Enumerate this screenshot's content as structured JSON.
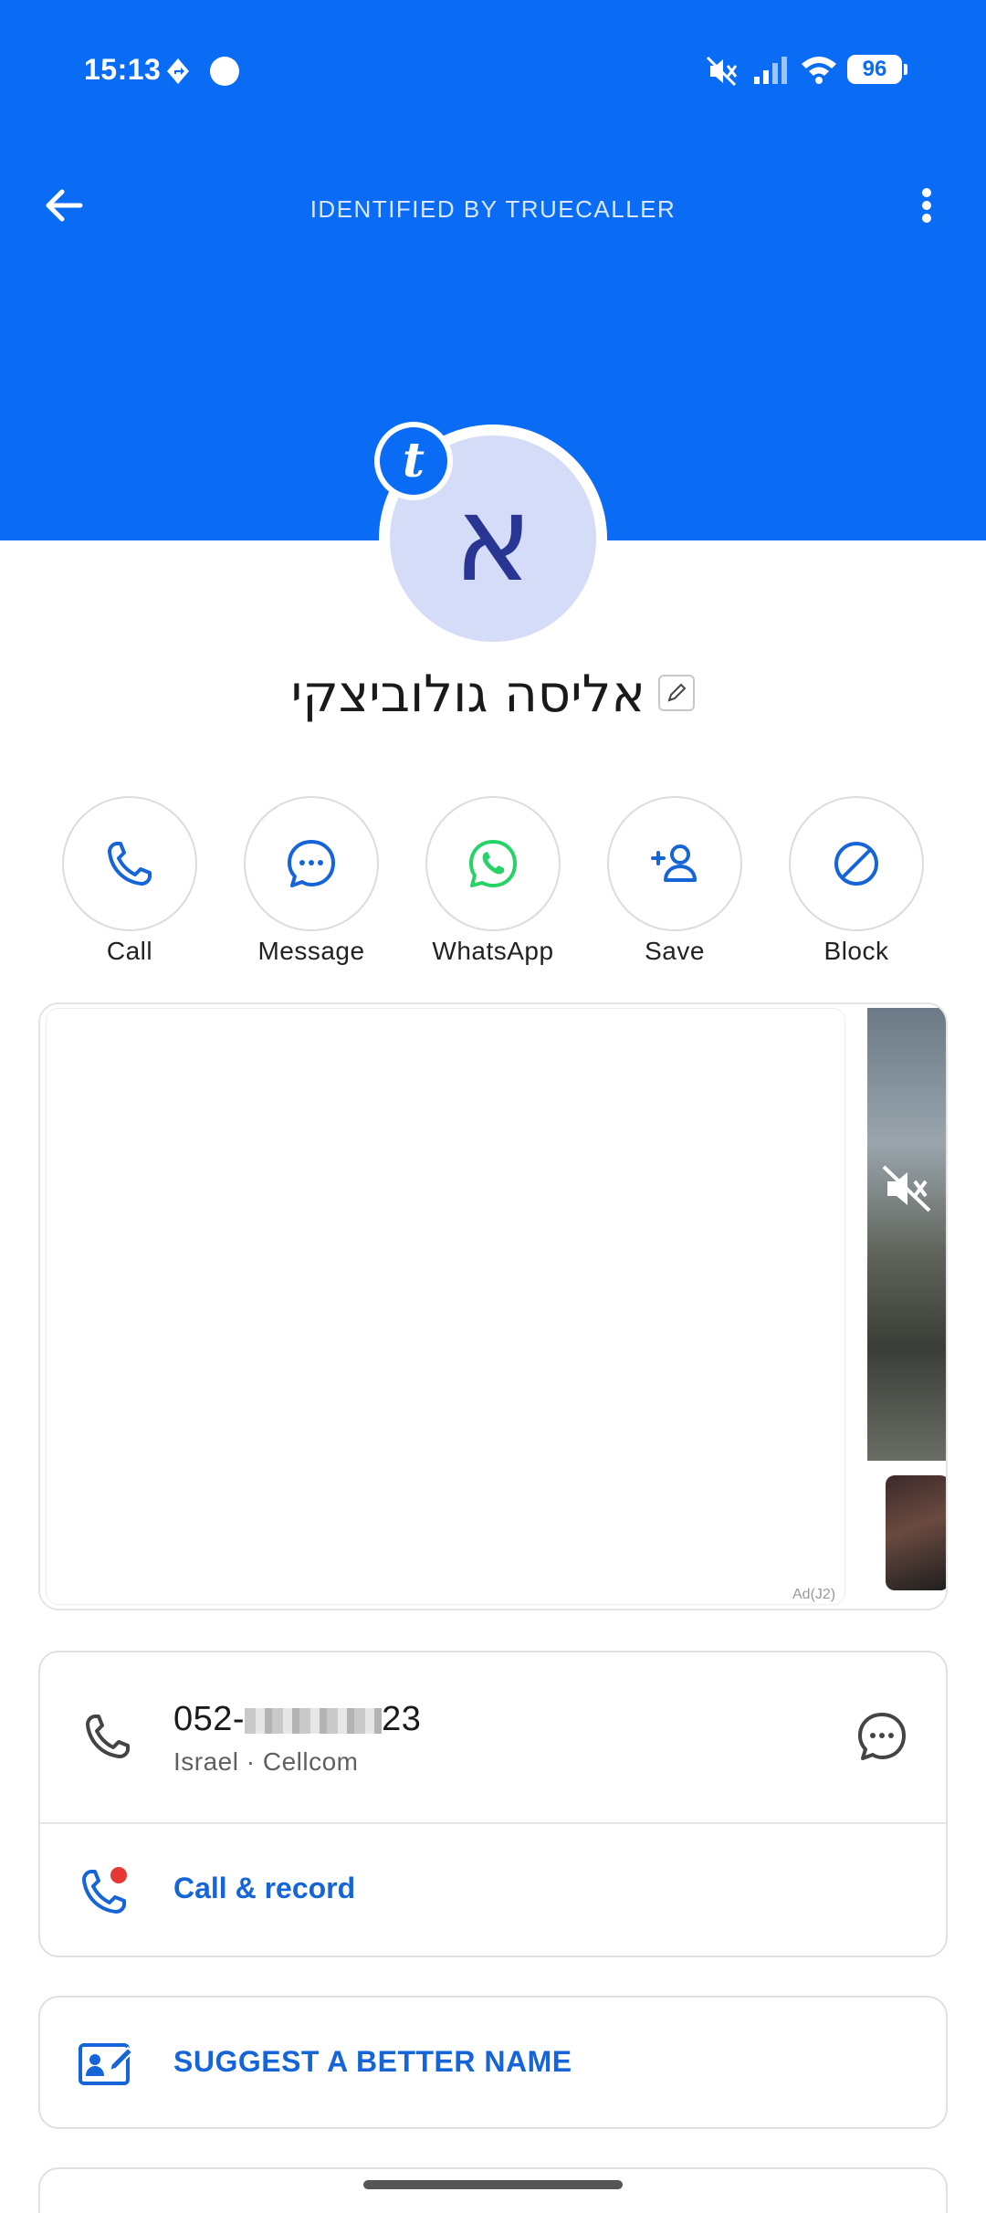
{
  "status_bar": {
    "time": "15:13",
    "battery": "96"
  },
  "header": {
    "title": "IDENTIFIED BY TRUECALLER"
  },
  "contact": {
    "avatar_letter": "א",
    "badge_letter": "t",
    "name": "אליסה גולוביצקי"
  },
  "actions": [
    {
      "label": "Call",
      "icon": "phone-icon"
    },
    {
      "label": "Message",
      "icon": "message-icon"
    },
    {
      "label": "WhatsApp",
      "icon": "whatsapp-icon"
    },
    {
      "label": "Save",
      "icon": "add-contact-icon"
    },
    {
      "label": "Block",
      "icon": "block-icon"
    }
  ],
  "ad": {
    "tag": "Ad(J2)"
  },
  "phone": {
    "number_prefix": "052-",
    "number_suffix": "23",
    "carrier": "Israel · Cellcom"
  },
  "call_record": {
    "label": "Call & record"
  },
  "suggest": {
    "label": "SUGGEST A BETTER NAME"
  },
  "colors": {
    "brand": "#0a6cf5",
    "link": "#1565d8",
    "whatsapp": "#25d366",
    "record_dot": "#e53935"
  }
}
